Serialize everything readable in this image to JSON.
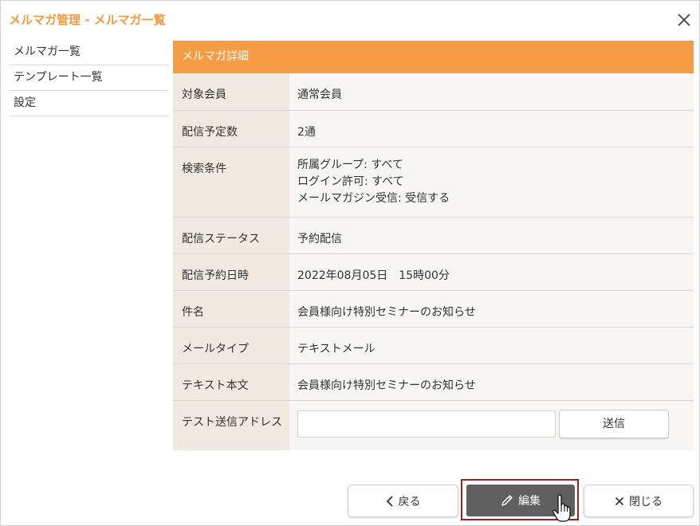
{
  "window": {
    "title": "メルマガ管理 - メルマガ一覧"
  },
  "sidebar": {
    "items": [
      {
        "label": "メルマガ一覧"
      },
      {
        "label": "テンプレート一覧"
      },
      {
        "label": "設定"
      }
    ]
  },
  "detail": {
    "header": "メルマガ詳細",
    "rows": [
      {
        "label": "対象会員",
        "value": "通常会員"
      },
      {
        "label": "配信予定数",
        "value": "2通"
      },
      {
        "label": "検索条件",
        "lines": [
          "所属グループ: すべて",
          "ログイン許可: すべて",
          "メールマガジン受信: 受信する"
        ]
      },
      {
        "label": "配信ステータス",
        "value": "予約配信"
      },
      {
        "label": "配信予約日時",
        "value": "2022年08月05日　15時00分"
      },
      {
        "label": "件名",
        "value": "会員様向け特別セミナーのお知らせ"
      },
      {
        "label": "メールタイプ",
        "value": "テキストメール"
      },
      {
        "label": "テキスト本文",
        "value": "会員様向け特別セミナーのお知らせ"
      },
      {
        "label": "テスト送信アドレス",
        "input_value": "",
        "send_label": "送信"
      }
    ]
  },
  "footer": {
    "back_label": "戻る",
    "edit_label": "編集",
    "close_label": "閉じる"
  },
  "colors": {
    "accent": "#f39a3f",
    "panel_header": "#f59c45",
    "label_bg": "#efe9e2",
    "value_bg": "#f8f6f4",
    "edit_button": "#5f5f5f",
    "highlight_outline": "#a51d24"
  },
  "icons": {
    "close": "close-icon",
    "back": "chevron-left-icon",
    "edit": "pencil-icon",
    "close_button": "x-icon",
    "cursor": "hand-pointer-icon"
  }
}
